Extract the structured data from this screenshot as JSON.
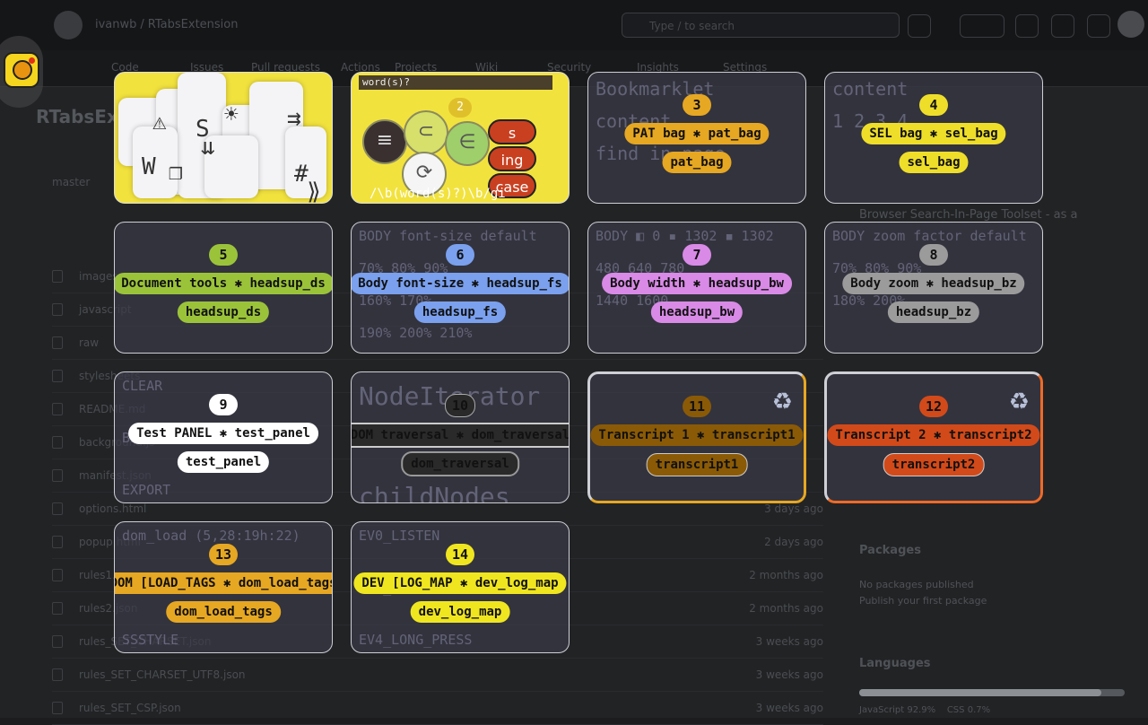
{
  "background": {
    "breadcrumb_user": "ivanwb",
    "breadcrumb_repo": "RTabsExtension",
    "search_placeholder": "Type / to search",
    "nav_tabs": [
      "Code",
      "Issues",
      "Pull requests",
      "Actions",
      "Projects",
      "Wiki",
      "Security",
      "Insights",
      "Settings"
    ],
    "repo_title": "RTabsExtension",
    "branch": "master",
    "about_text": "Browser Search-In-Page Toolset - as a",
    "files": [
      {
        "name": "images",
        "date": ""
      },
      {
        "name": "javascript",
        "date": ""
      },
      {
        "name": "raw",
        "date": ""
      },
      {
        "name": "stylesheets",
        "date": ""
      },
      {
        "name": "README.md",
        "date": ""
      },
      {
        "name": "background.js",
        "date": ""
      },
      {
        "name": "manifest.json",
        "date": ""
      },
      {
        "name": "options.html",
        "date": "3 days ago"
      },
      {
        "name": "popup.html",
        "date": "2 days ago"
      },
      {
        "name": "rules1.json",
        "date": "2 months ago"
      },
      {
        "name": "rules2.json",
        "date": "2 months ago"
      },
      {
        "name": "rules_SET_CHARSET.json",
        "date": "3 weeks ago"
      },
      {
        "name": "rules_SET_CHARSET_UTF8.json",
        "date": "3 weeks ago"
      },
      {
        "name": "rules_SET_CSP.json",
        "date": "3 weeks ago"
      }
    ],
    "packages_title": "Packages",
    "packages_none": "No packages published",
    "packages_link": "Publish your first package",
    "languages_title": "Languages",
    "lang_js": "JavaScript",
    "lang_js_pct": "92.9%",
    "lang_css": "CSS",
    "lang_css_pct": "0.7%"
  },
  "tiles": [
    {
      "num": "",
      "label": "",
      "key": "",
      "bright": true
    },
    {
      "num": "",
      "label": "",
      "key": "",
      "bright": true,
      "bar_text": "word(s)?",
      "regex": "/\\b(word(s)?)\\b/gi",
      "bubbles": [
        "≡",
        "⊂",
        "∈",
        "⟳"
      ],
      "red_buttons": [
        "s",
        "ing",
        "case"
      ],
      "counter": "2"
    },
    {
      "num": "3",
      "label": "PAT bag ✱ pat_bag",
      "key": "pat_bag",
      "color": "#e6a722",
      "faint": [
        "Bookmarklet",
        "content",
        "find in page"
      ]
    },
    {
      "num": "4",
      "label": "SEL bag ✱ sel_bag",
      "key": "sel_bag",
      "color": "#eede2a",
      "faint": [
        "content",
        "1 2 3 4"
      ]
    },
    {
      "num": "5",
      "label": "Document tools ✱ headsup_ds",
      "key": "headsup_ds",
      "color": "#9bc33a",
      "faint": []
    },
    {
      "num": "6",
      "label": "Body font-size ✱ headsup_fs",
      "key": "headsup_fs",
      "color": "#7aa0ee",
      "faint": [
        "BODY font-size default",
        "70% 80% 90%",
        "160% 170%",
        "190% 200% 210%"
      ]
    },
    {
      "num": "7",
      "label": "Body width ✱ headsup_bw",
      "key": "headsup_bw",
      "color": "#d88ae6",
      "faint": [
        "BODY ◧ 0 ▪ 1302 ◾ 1302",
        "480 640 780",
        "1440 1600"
      ]
    },
    {
      "num": "8",
      "label": "Body zoom ✱ headsup_bz",
      "key": "headsup_bz",
      "color": "#9b9b9b",
      "faint": [
        "BODY zoom factor default",
        "70% 80% 90%",
        "180% 200%"
      ]
    },
    {
      "num": "9",
      "label": "Test PANEL ✱ test_panel",
      "key": "test_panel",
      "color": "#ffffff",
      "faint": [
        "CLEAR",
        "BEHAVIOR",
        "EXPORT"
      ]
    },
    {
      "num": "10",
      "label": "DOM traversal ✱ dom_traversal",
      "key": "dom_traversal",
      "color": "#2a2a2a",
      "dark": true,
      "faint": [
        "NodeIterator",
        "childNodes"
      ]
    },
    {
      "num": "11",
      "label": "Transcript 1 ✱ transcript1",
      "key": "transcript1",
      "color": "#8a5a06",
      "recycle": true,
      "border": "#e6a722"
    },
    {
      "num": "12",
      "label": "Transcript 2 ✱ transcript2",
      "key": "transcript2",
      "color": "#d24a1a",
      "recycle": true,
      "border": "#ef6a26"
    },
    {
      "num": "13",
      "label": "DOM [LOAD_TAGS ✱ dom_load_tags",
      "key": "dom_load_tags",
      "color": "#e6a722",
      "faint": [
        "dom_load (5,28:19h:22)",
        "DOM",
        "SSSTYLE"
      ]
    },
    {
      "num": "14",
      "label": "DEV [LOG_MAP ✱ dev_log_map",
      "key": "dev_log_map",
      "color": "#f0e620",
      "faint": [
        "EV0_LISTEN",
        "EV1_DOWN",
        "EV4_LONG_PRESS"
      ]
    }
  ],
  "recycle_icon": "recycle-icon"
}
